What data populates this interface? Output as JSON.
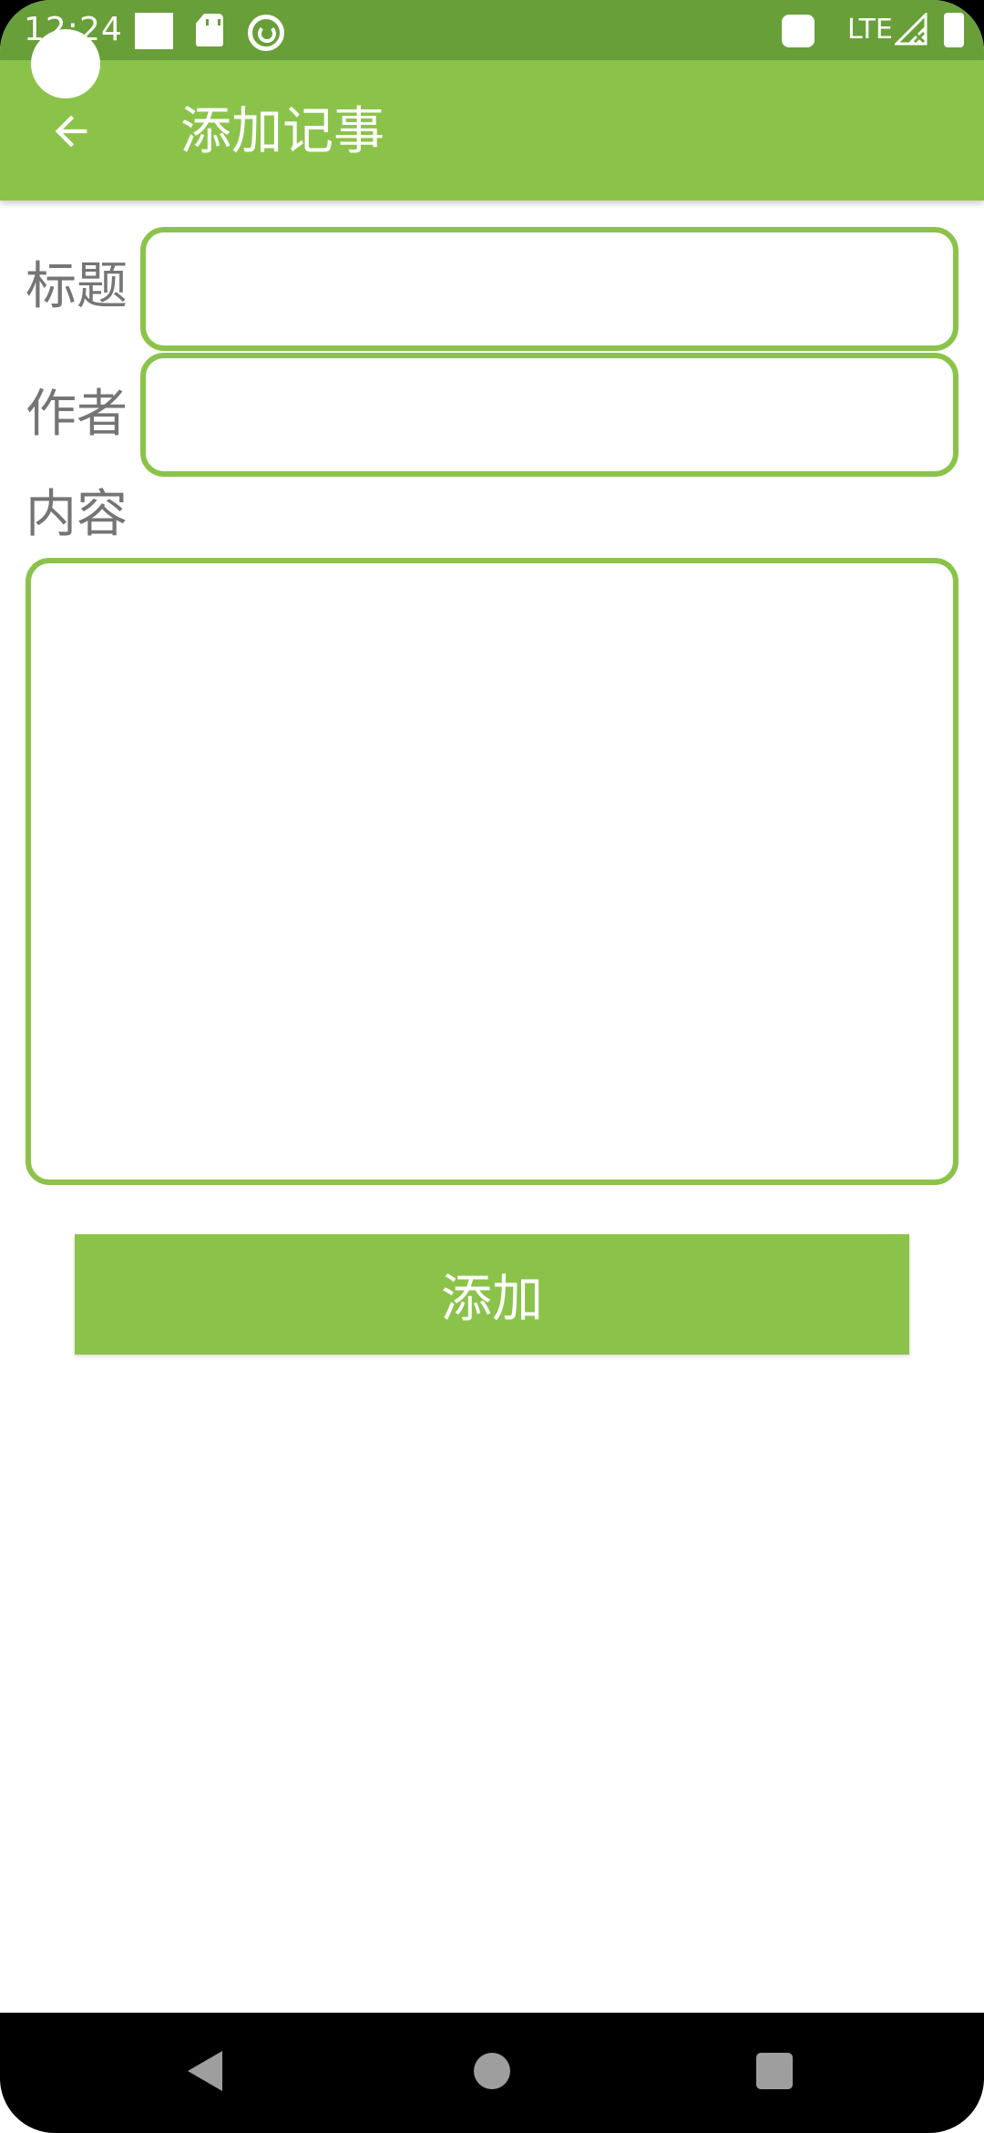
{
  "status_bar": {
    "time": "12:24",
    "network": "LTE",
    "icons": [
      "notification-square-icon",
      "sd-card-icon",
      "data-saver-icon",
      "notification-icon",
      "signal-icon",
      "battery-icon"
    ]
  },
  "app_bar": {
    "title": "添加记事",
    "back_icon": "arrow-back-icon"
  },
  "form": {
    "title_label": "标题",
    "title_value": "",
    "author_label": "作者",
    "author_value": "",
    "content_label": "内容",
    "content_value": ""
  },
  "actions": {
    "add_label": "添加"
  },
  "nav_bar": {
    "icons": [
      "nav-back-icon",
      "nav-home-icon",
      "nav-recents-icon"
    ]
  },
  "colors": {
    "primary": "#8BC34A",
    "primary_dark": "#689F38",
    "label_text": "#757575"
  }
}
